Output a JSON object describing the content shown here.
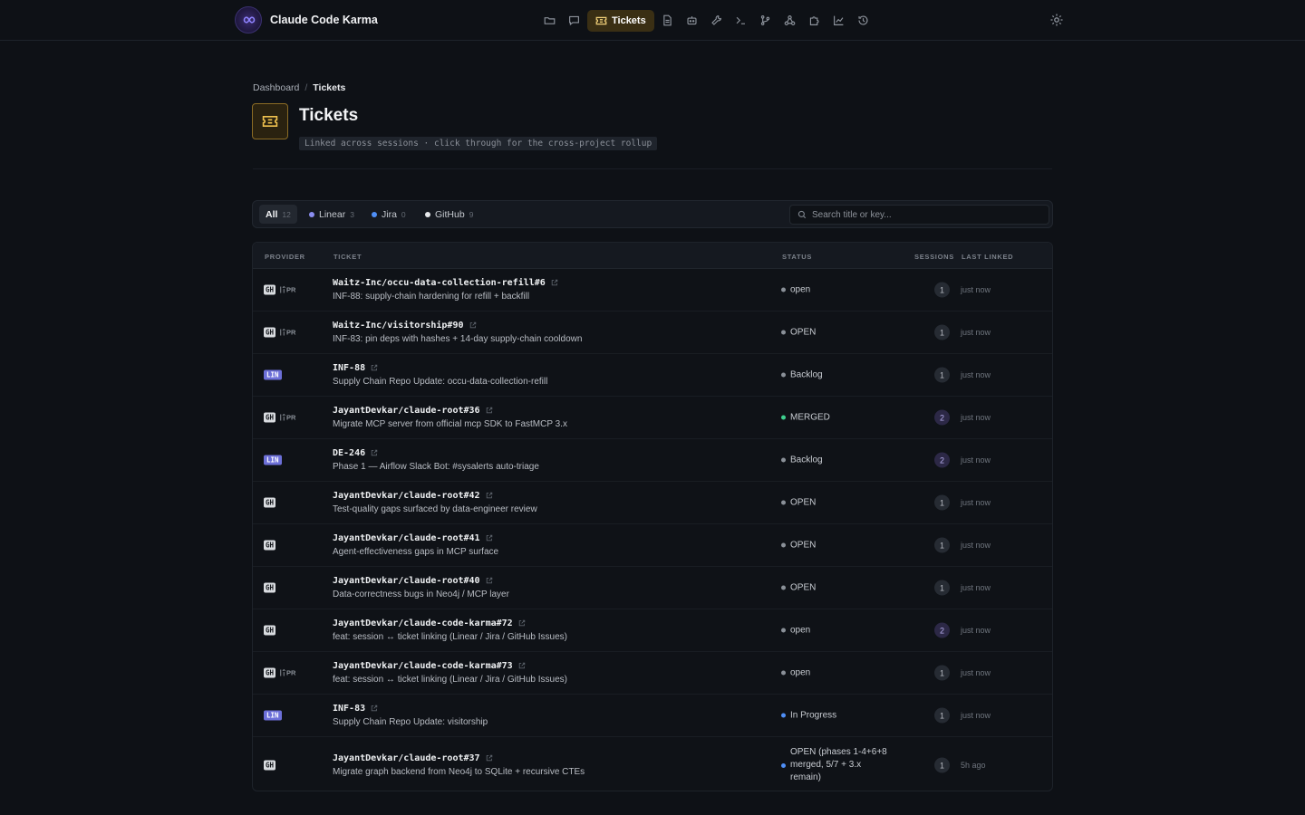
{
  "app": {
    "name": "Claude Code Karma"
  },
  "nav": {
    "active_label": "Tickets",
    "icons": [
      "folder-icon",
      "chat-icon",
      "ticket-icon",
      "document-icon",
      "robot-icon",
      "wrench-icon",
      "terminal-icon",
      "branch-icon",
      "webhook-icon",
      "puzzle-icon",
      "chart-icon",
      "history-icon"
    ]
  },
  "breadcrumb": {
    "root": "Dashboard",
    "separator": "/",
    "current": "Tickets"
  },
  "header": {
    "title": "Tickets",
    "subtitle": "Linked across sessions · click through for the cross-project rollup"
  },
  "filters": {
    "tabs": [
      {
        "label": "All",
        "count": "12",
        "color": ""
      },
      {
        "label": "Linear",
        "count": "3",
        "color": "#8b8ef0"
      },
      {
        "label": "Jira",
        "count": "0",
        "color": "#4f8ff7"
      },
      {
        "label": "GitHub",
        "count": "9",
        "color": "#e6e8eb"
      }
    ],
    "search_placeholder": "Search title or key..."
  },
  "table": {
    "headers": {
      "provider": "PROVIDER",
      "ticket": "TICKET",
      "status": "STATUS",
      "sessions": "SESSIONS",
      "last_linked": "LAST LINKED"
    },
    "rows": [
      {
        "provider": "GH",
        "pr": "PR",
        "key": "Waitz-Inc/occu-data-collection-refill#6",
        "title": "INF-88: supply-chain hardening for refill + backfill",
        "status": "open",
        "status_color": "#8a9098",
        "sessions": "1",
        "last": "just now"
      },
      {
        "provider": "GH",
        "pr": "PR",
        "key": "Waitz-Inc/visitorship#90",
        "title": "INF-83: pin deps with hashes + 14-day supply-chain cooldown",
        "status": "OPEN",
        "status_color": "#8a9098",
        "sessions": "1",
        "last": "just now"
      },
      {
        "provider": "LIN",
        "pr": "",
        "key": "INF-88",
        "title": "Supply Chain Repo Update: occu-data-collection-refill",
        "status": "Backlog",
        "status_color": "#8a9098",
        "sessions": "1",
        "last": "just now"
      },
      {
        "provider": "GH",
        "pr": "PR",
        "key": "JayantDevkar/claude-root#36",
        "title": "Migrate MCP server from official mcp SDK to FastMCP 3.x",
        "status": "MERGED",
        "status_color": "#3ecf8e",
        "sessions": "2",
        "last": "just now"
      },
      {
        "provider": "LIN",
        "pr": "",
        "key": "DE-246",
        "title": "Phase 1 — Airflow Slack Bot: #sysalerts auto-triage",
        "status": "Backlog",
        "status_color": "#8a9098",
        "sessions": "2",
        "last": "just now"
      },
      {
        "provider": "GH",
        "pr": "",
        "key": "JayantDevkar/claude-root#42",
        "title": "Test-quality gaps surfaced by data-engineer review",
        "status": "OPEN",
        "status_color": "#8a9098",
        "sessions": "1",
        "last": "just now"
      },
      {
        "provider": "GH",
        "pr": "",
        "key": "JayantDevkar/claude-root#41",
        "title": "Agent-effectiveness gaps in MCP surface",
        "status": "OPEN",
        "status_color": "#8a9098",
        "sessions": "1",
        "last": "just now"
      },
      {
        "provider": "GH",
        "pr": "",
        "key": "JayantDevkar/claude-root#40",
        "title": "Data-correctness bugs in Neo4j / MCP layer",
        "status": "OPEN",
        "status_color": "#8a9098",
        "sessions": "1",
        "last": "just now"
      },
      {
        "provider": "GH",
        "pr": "",
        "key": "JayantDevkar/claude-code-karma#72",
        "title": "feat: session ↔ ticket linking (Linear / Jira / GitHub Issues)",
        "status": "open",
        "status_color": "#8a9098",
        "sessions": "2",
        "last": "just now"
      },
      {
        "provider": "GH",
        "pr": "PR",
        "key": "JayantDevkar/claude-code-karma#73",
        "title": "feat: session ↔ ticket linking (Linear / Jira / GitHub Issues)",
        "status": "open",
        "status_color": "#8a9098",
        "sessions": "1",
        "last": "just now"
      },
      {
        "provider": "LIN",
        "pr": "",
        "key": "INF-83",
        "title": "Supply Chain Repo Update: visitorship",
        "status": "In Progress",
        "status_color": "#4f8ff7",
        "sessions": "1",
        "last": "just now"
      },
      {
        "provider": "GH",
        "pr": "",
        "key": "JayantDevkar/claude-root#37",
        "title": "Migrate graph backend from Neo4j to SQLite + recursive CTEs",
        "status": "OPEN (phases 1-4+6+8 merged, 5/7 + 3.x remain)",
        "status_color": "#4f8ff7",
        "sessions": "1",
        "last": "5h ago"
      }
    ]
  }
}
